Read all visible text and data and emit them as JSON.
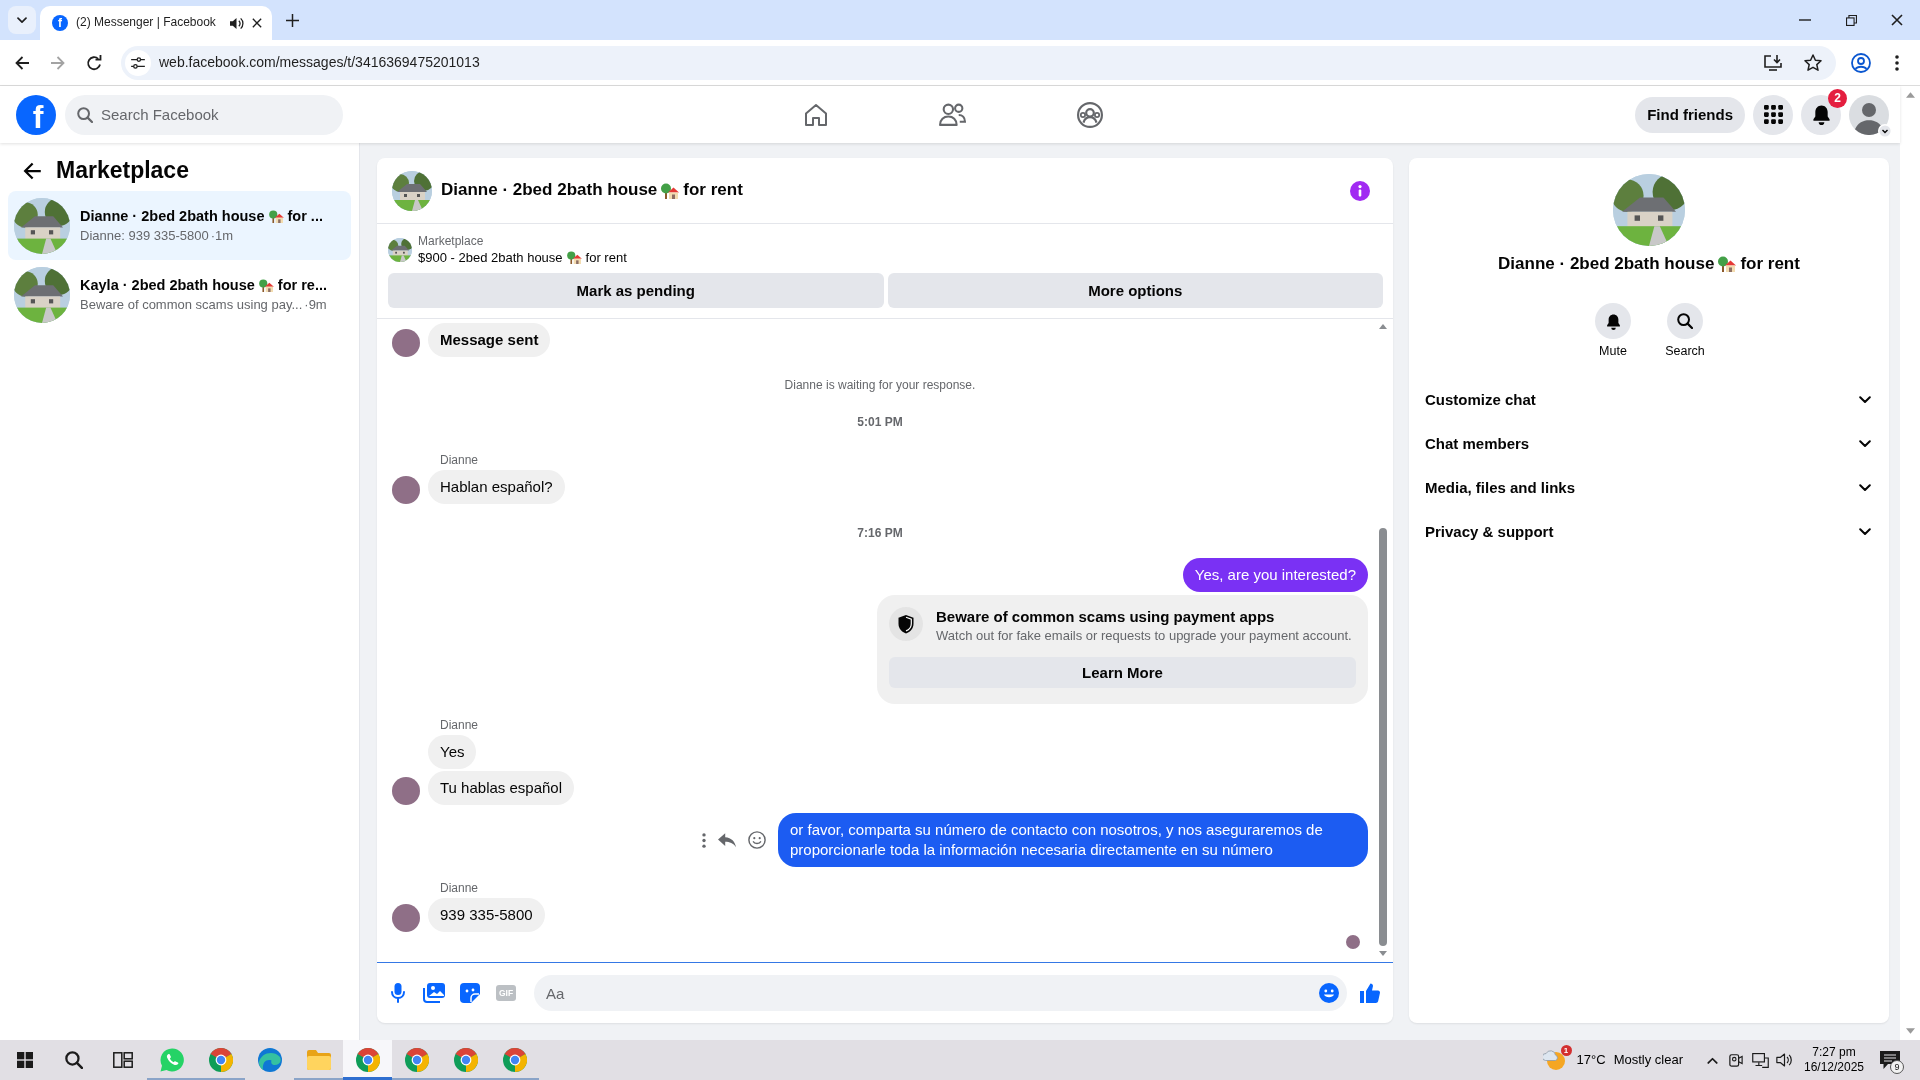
{
  "browser": {
    "tab": {
      "icon_letter": "f",
      "title": "(2) Messenger | Facebook",
      "audio": true
    },
    "url": "web.facebook.com/messages/t/3416369475201013"
  },
  "topbar": {
    "logo_letter": "f",
    "search": {
      "placeholder": "Search Facebook"
    },
    "nav": [
      {
        "kind": "home"
      },
      {
        "kind": "friends"
      },
      {
        "kind": "groups"
      }
    ],
    "find_friends": "Find friends",
    "notification_count": "2"
  },
  "sidebar": {
    "title": "Marketplace",
    "conversations": [
      {
        "title_parts": [
          "Dianne · 2bed 2bath house",
          "for ..."
        ],
        "preview": "Dianne: 939 335-5800",
        "time": "·1m",
        "selected": true
      },
      {
        "title_parts": [
          "Kayla · 2bed 2bath house",
          "for re..."
        ],
        "preview": "Beware of common scams using pay...",
        "time": "·9m",
        "selected": false
      }
    ]
  },
  "chat": {
    "title_parts": [
      "Dianne · 2bed 2bath house",
      "for rent"
    ],
    "listing": {
      "label": "Marketplace",
      "title_parts": [
        "$900 - 2bed 2bath house",
        "for rent"
      ]
    },
    "buttons": [
      "Mark as pending",
      "More options"
    ],
    "messages": [
      {
        "kind": "incoming",
        "text": "Message sent",
        "bold": true,
        "avatar": true
      },
      {
        "kind": "notice",
        "text": "Dianne is waiting for your response."
      },
      {
        "kind": "time",
        "text": "5:01 PM"
      },
      {
        "kind": "incoming",
        "sender": "Dianne",
        "text": "Hablan español?",
        "avatar": true
      },
      {
        "kind": "time",
        "text": "7:16 PM"
      },
      {
        "kind": "outgoing",
        "text": "Yes, are you interested?",
        "color": "#7a31f4"
      },
      {
        "kind": "alert",
        "title": "Beware of common scams using payment apps",
        "text": "Watch out for fake emails or requests to upgrade your payment account.",
        "button": "Learn More"
      },
      {
        "kind": "incoming",
        "sender": "Dianne",
        "text": "Yes",
        "avatar": false
      },
      {
        "kind": "incoming",
        "text": "Tu hablas español",
        "avatar": true
      },
      {
        "kind": "outgoing",
        "text": "or favor, comparta su número de contacto con nosotros, y nos aseguraremos de proporcionarle toda la información necesaria directamente en su número",
        "color": "#1c5cf2",
        "hover_actions": true
      },
      {
        "kind": "incoming",
        "sender": "Dianne",
        "text": "939 335-5800",
        "avatar": true
      }
    ],
    "seen": true,
    "composer": {
      "tools": [
        {
          "kind": "mic"
        },
        {
          "kind": "photo"
        },
        {
          "kind": "sticker"
        },
        {
          "kind": "gif",
          "label": "GIF"
        }
      ],
      "placeholder": "Aa"
    }
  },
  "details": {
    "title_parts": [
      "Dianne · 2bed 2bath house",
      "for rent"
    ],
    "actions": [
      {
        "kind": "mute",
        "label": "Mute"
      },
      {
        "kind": "search",
        "label": "Search"
      }
    ],
    "sections": [
      {
        "label": "Customize chat",
        "expanded": false
      },
      {
        "label": "Chat members",
        "expanded": false
      },
      {
        "label": "Media, files and links",
        "expanded": false
      },
      {
        "label": "Privacy & support",
        "expanded": false
      }
    ]
  },
  "taskbar": {
    "system": [
      {
        "kind": "start"
      },
      {
        "kind": "search"
      },
      {
        "kind": "task_view"
      }
    ],
    "apps": [
      {
        "kind": "chat",
        "running": true,
        "selected": false
      },
      {
        "kind": "browser",
        "running": true,
        "selected": false
      },
      {
        "kind": "browser2",
        "running": false,
        "selected": false
      },
      {
        "kind": "folder",
        "running": true,
        "selected": false
      },
      {
        "kind": "browser",
        "running": true,
        "selected": true
      },
      {
        "kind": "browser",
        "running": true,
        "selected": false
      },
      {
        "kind": "browser",
        "running": true,
        "selected": false
      },
      {
        "kind": "browser",
        "running": true,
        "selected": false
      }
    ],
    "weather": {
      "temperature": "17°C",
      "condition": "Mostly clear",
      "alert_count": "1"
    },
    "clock": {
      "time": "7:27 pm",
      "date": "16/12/2025"
    },
    "notification_count": "9"
  }
}
